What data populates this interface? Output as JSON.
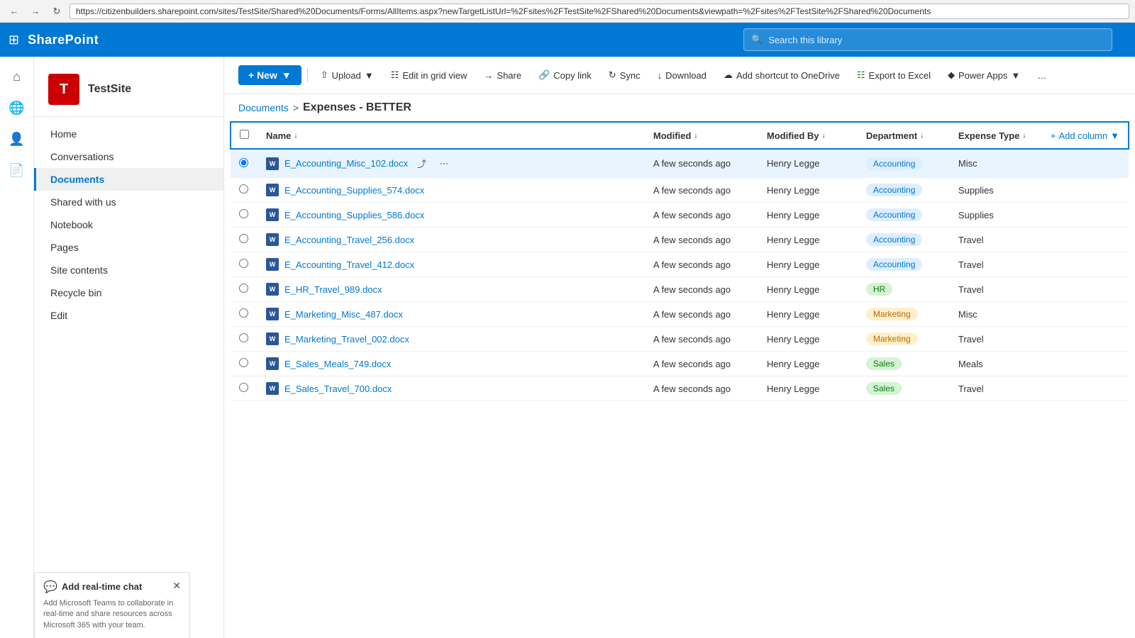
{
  "browser": {
    "url": "https://citizenbuilders.sharepoint.com/sites/TestSite/Shared%20Documents/Forms/AllItems.aspx?newTargetListUrl=%2Fsites%2FTestSite%2FShared%20Documents&viewpath=%2Fsites%2FTestSite%2FShared%20Documents",
    "back_label": "←",
    "forward_label": "→",
    "refresh_label": "↻"
  },
  "topbar": {
    "waffle_icon": "⊞",
    "brand": "SharePoint",
    "search_placeholder": "Search this library"
  },
  "site": {
    "icon_letter": "T",
    "name": "TestSite"
  },
  "nav": {
    "items": [
      {
        "id": "home",
        "label": "Home"
      },
      {
        "id": "conversations",
        "label": "Conversations"
      },
      {
        "id": "documents",
        "label": "Documents",
        "active": true
      },
      {
        "id": "shared",
        "label": "Shared with us"
      },
      {
        "id": "notebook",
        "label": "Notebook"
      },
      {
        "id": "pages",
        "label": "Pages"
      },
      {
        "id": "sitecontents",
        "label": "Site contents"
      },
      {
        "id": "recycle",
        "label": "Recycle bin"
      },
      {
        "id": "edit",
        "label": "Edit"
      }
    ]
  },
  "global_nav_icons": [
    "home-icon",
    "globe-icon",
    "user-icon",
    "note-icon"
  ],
  "toolbar": {
    "new_label": "+ New",
    "upload_label": "Upload",
    "edit_grid_label": "Edit in grid view",
    "share_label": "Share",
    "copy_link_label": "Copy link",
    "sync_label": "Sync",
    "download_label": "Download",
    "add_shortcut_label": "Add shortcut to OneDrive",
    "export_excel_label": "Export to Excel",
    "power_apps_label": "Power Apps"
  },
  "breadcrumb": {
    "parent": "Documents",
    "separator": ">",
    "current": "Expenses - BETTER"
  },
  "table": {
    "columns": [
      {
        "id": "name",
        "label": "Name",
        "sortable": true,
        "sort_icon": "↓"
      },
      {
        "id": "modified",
        "label": "Modified",
        "sortable": true,
        "sort_icon": "↓"
      },
      {
        "id": "modifiedby",
        "label": "Modified By",
        "sortable": true,
        "sort_icon": "↓"
      },
      {
        "id": "department",
        "label": "Department",
        "sortable": true,
        "sort_icon": "↓"
      },
      {
        "id": "expensetype",
        "label": "Expense Type",
        "sortable": true,
        "sort_icon": "↓"
      }
    ],
    "add_column_label": "+ Add column",
    "rows": [
      {
        "id": "row1",
        "name": "E_Accounting_Misc_102.docx",
        "modified": "A few seconds ago",
        "modified_by": "Henry Legge",
        "department": "Accounting",
        "dept_class": "dept-accounting",
        "expense_type": "Misc",
        "selected": true
      },
      {
        "id": "row2",
        "name": "E_Accounting_Supplies_574.docx",
        "modified": "A few seconds ago",
        "modified_by": "Henry Legge",
        "department": "Accounting",
        "dept_class": "dept-accounting",
        "expense_type": "Supplies",
        "selected": false
      },
      {
        "id": "row3",
        "name": "E_Accounting_Supplies_586.docx",
        "modified": "A few seconds ago",
        "modified_by": "Henry Legge",
        "department": "Accounting",
        "dept_class": "dept-accounting",
        "expense_type": "Supplies",
        "selected": false
      },
      {
        "id": "row4",
        "name": "E_Accounting_Travel_256.docx",
        "modified": "A few seconds ago",
        "modified_by": "Henry Legge",
        "department": "Accounting",
        "dept_class": "dept-accounting",
        "expense_type": "Travel",
        "selected": false
      },
      {
        "id": "row5",
        "name": "E_Accounting_Travel_412.docx",
        "modified": "A few seconds ago",
        "modified_by": "Henry Legge",
        "department": "Accounting",
        "dept_class": "dept-accounting",
        "expense_type": "Travel",
        "selected": false
      },
      {
        "id": "row6",
        "name": "E_HR_Travel_989.docx",
        "modified": "A few seconds ago",
        "modified_by": "Henry Legge",
        "department": "HR",
        "dept_class": "dept-hr",
        "expense_type": "Travel",
        "selected": false
      },
      {
        "id": "row7",
        "name": "E_Marketing_Misc_487.docx",
        "modified": "A few seconds ago",
        "modified_by": "Henry Legge",
        "department": "Marketing",
        "dept_class": "dept-marketing",
        "expense_type": "Misc",
        "selected": false
      },
      {
        "id": "row8",
        "name": "E_Marketing_Travel_002.docx",
        "modified": "A few seconds ago",
        "modified_by": "Henry Legge",
        "department": "Marketing",
        "dept_class": "dept-marketing",
        "expense_type": "Travel",
        "selected": false
      },
      {
        "id": "row9",
        "name": "E_Sales_Meals_749.docx",
        "modified": "A few seconds ago",
        "modified_by": "Henry Legge",
        "department": "Sales",
        "dept_class": "dept-sales",
        "expense_type": "Meals",
        "selected": false
      },
      {
        "id": "row10",
        "name": "E_Sales_Travel_700.docx",
        "modified": "A few seconds ago",
        "modified_by": "Henry Legge",
        "department": "Sales",
        "dept_class": "dept-sales",
        "expense_type": "Travel",
        "selected": false
      }
    ]
  },
  "chat": {
    "icon": "💬",
    "title": "Add real-time chat",
    "description": "Add Microsoft Teams to collaborate in real-time and share resources across Microsoft 365 with your team.",
    "close_icon": "✕"
  }
}
